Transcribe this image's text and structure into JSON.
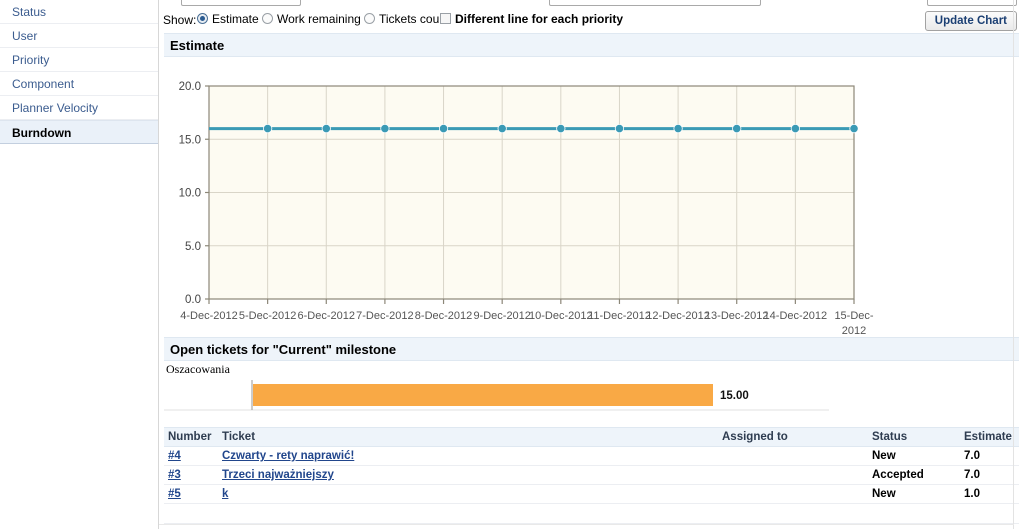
{
  "sidebar": {
    "items": [
      {
        "label": "Status",
        "active": false
      },
      {
        "label": "User",
        "active": false
      },
      {
        "label": "Priority",
        "active": false
      },
      {
        "label": "Component",
        "active": false
      },
      {
        "label": "Planner Velocity",
        "active": false
      },
      {
        "label": "Burndown",
        "active": true
      }
    ]
  },
  "toolbar": {
    "show_label": "Show:",
    "options": [
      {
        "label": "Estimate",
        "type": "radio",
        "checked": true
      },
      {
        "label": "Work remaining",
        "type": "radio",
        "checked": false
      },
      {
        "label": "Tickets count",
        "type": "radio",
        "checked": false
      },
      {
        "label": "Different line for each priority",
        "type": "checkbox",
        "checked": false
      }
    ],
    "update_button": "Update Chart"
  },
  "panels": {
    "estimate_header": "Estimate",
    "open_tickets_header": "Open tickets for \"Current\" milestone"
  },
  "chart_data": [
    {
      "type": "line",
      "title": "Estimate",
      "xlabel": "",
      "ylabel": "",
      "ylim": [
        0,
        20
      ],
      "yticks": [
        "0.0",
        "5.0",
        "10.0",
        "15.0",
        "20.0"
      ],
      "ytick_values": [
        0,
        5,
        10,
        15,
        20
      ],
      "grid": true,
      "legend": "none",
      "plot_bg": "#fdfbf2",
      "line_color": "#3a9ab5",
      "marker_color": "#3a9ab5",
      "categories": [
        "4-Dec-2012",
        "5-Dec-2012",
        "6-Dec-2012",
        "7-Dec-2012",
        "8-Dec-2012",
        "9-Dec-2012",
        "10-Dec-2012",
        "11-Dec-2012",
        "12-Dec-2012",
        "13-Dec-2012",
        "14-Dec-2012",
        "15-Dec-2012"
      ],
      "xtick_wrap_last": "2012",
      "series": [
        {
          "name": "Estimate",
          "values": [
            null,
            16,
            16,
            16,
            16,
            16,
            16,
            16,
            16,
            16,
            16,
            16
          ]
        }
      ]
    },
    {
      "type": "bar",
      "orientation": "horizontal",
      "title": "Oszacowania",
      "categories": [
        "Oszacowania"
      ],
      "values": [
        15.0
      ],
      "value_labels": [
        "15.00"
      ],
      "bar_color": "#f9a945",
      "xlim": [
        0,
        20
      ],
      "grid": false
    }
  ],
  "table": {
    "columns": [
      "Number",
      "Ticket",
      "Assigned to",
      "Status",
      "Estimate"
    ],
    "rows": [
      {
        "number": "#4",
        "ticket": "Czwarty - rety naprawić!",
        "assigned": "",
        "status": "New",
        "estimate": "7.0"
      },
      {
        "number": "#3",
        "ticket": "Trzeci najważniejszy",
        "assigned": "",
        "status": "Accepted",
        "estimate": "7.0"
      },
      {
        "number": "#5",
        "ticket": "k",
        "assigned": "",
        "status": "New",
        "estimate": "1.0"
      }
    ]
  }
}
